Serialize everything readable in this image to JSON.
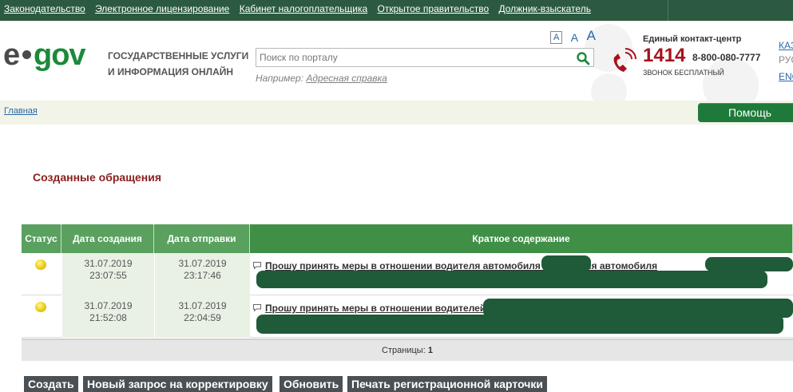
{
  "top_nav": {
    "links": [
      "Законодательство",
      "Электронное лицензирование",
      "Кабинет налогоплательщика",
      "Открытое правительство",
      "Должник-взыскатель"
    ]
  },
  "logo": {
    "e": "e",
    "gov": "gov",
    "tagline_line1": "ГОСУДАРСТВЕННЫЕ УСЛУГИ",
    "tagline_line2": "И ИНФОРМАЦИЯ ОНЛАЙН"
  },
  "font_size": {
    "small": "A",
    "medium": "A",
    "large": "A"
  },
  "search": {
    "placeholder": "Поиск по порталу",
    "example_label": "Например:",
    "example_link": "Адресная справка"
  },
  "contact": {
    "title": "Единый контакт-центр",
    "short_number": "1414",
    "phone": "8-800-080-7777",
    "free_call": "ЗВОНОК БЕСПЛАТНЫЙ"
  },
  "languages": {
    "kz": "КАЗ",
    "ru": "РУС",
    "en": "ENG"
  },
  "breadcrumb": {
    "home": "Главная"
  },
  "help_button": "Помощь",
  "page": {
    "section_title": "Созданные обращения"
  },
  "table": {
    "headers": {
      "status": "Статус",
      "created": "Дата создания",
      "sent": "Дата отправки",
      "summary": "Краткое содержание"
    },
    "rows": [
      {
        "status": "yellow",
        "created_date": "31.07.2019",
        "created_time": "23:07:55",
        "sent_date": "31.07.2019",
        "sent_time": "23:17:46",
        "summary": "Прошу принять меры в отношении водителя автомобиля           и водителя автомобиля"
      },
      {
        "status": "yellow",
        "created_date": "31.07.2019",
        "created_time": "21:52:08",
        "sent_date": "31.07.2019",
        "sent_time": "22:04:59",
        "summary": "Прошу принять меры в отношении водителей"
      }
    ],
    "pagination_label": "Страницы:",
    "pagination_value": "1"
  },
  "buttons": {
    "create": "Создать",
    "new_correction": "Новый запрос на корректировку",
    "refresh": "Обновить",
    "print_card": "Печать регистрационной карточки"
  },
  "colors": {
    "top_bar": "#2c5a41",
    "brand_green": "#1b8a3a",
    "table_header": "#3f8f46",
    "accent_red": "#a6121b",
    "section_title": "#8a1f1f"
  },
  "icons": [
    "search-icon",
    "phone-icon",
    "status-dot-icon",
    "message-icon"
  ]
}
